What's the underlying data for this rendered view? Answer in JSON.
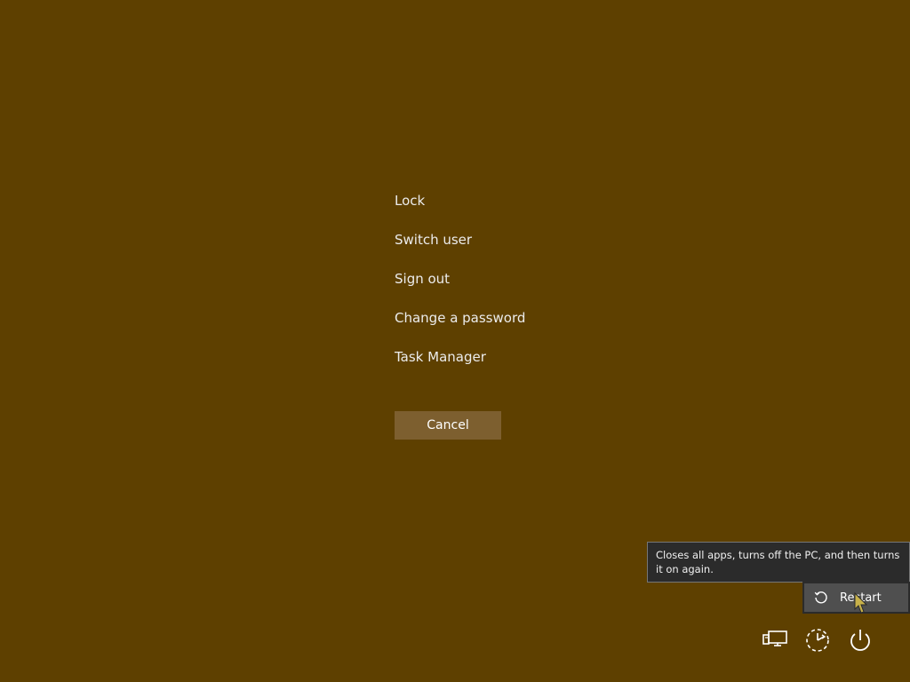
{
  "menu": {
    "items": [
      {
        "label": "Lock"
      },
      {
        "label": "Switch user"
      },
      {
        "label": "Sign out"
      },
      {
        "label": "Change a password"
      },
      {
        "label": "Task Manager"
      }
    ],
    "cancel_label": "Cancel"
  },
  "tooltip": {
    "text": "Closes all apps, turns off the PC, and then turns it on again."
  },
  "power_menu": {
    "restart_label": "Restart",
    "restart_icon": "restart-icon"
  },
  "tray": {
    "network_icon": "network-icon",
    "accessibility_icon": "ease-of-access-icon",
    "power_icon": "power-icon"
  },
  "colors": {
    "background": "#5e4000",
    "cancel_button": "#7d5f2f",
    "tooltip_bg": "#2b2b2b"
  }
}
